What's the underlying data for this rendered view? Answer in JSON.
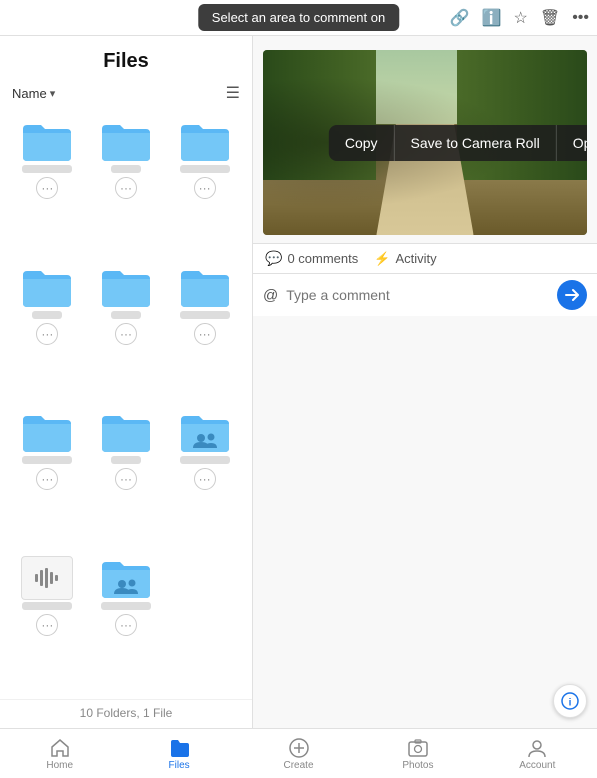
{
  "topbar": {
    "tooltip": "Select an area to comment on",
    "icons": [
      "link",
      "info",
      "star",
      "trash",
      "more"
    ]
  },
  "left": {
    "title": "Files",
    "sort_label": "Name",
    "folders": [
      {
        "id": 1,
        "type": "folder",
        "shared": false
      },
      {
        "id": 2,
        "type": "folder",
        "shared": false
      },
      {
        "id": 3,
        "type": "folder",
        "shared": false
      },
      {
        "id": 4,
        "type": "folder",
        "shared": false
      },
      {
        "id": 5,
        "type": "folder",
        "shared": false
      },
      {
        "id": 6,
        "type": "folder",
        "shared": false
      },
      {
        "id": 7,
        "type": "folder",
        "shared": false
      },
      {
        "id": 8,
        "type": "folder",
        "shared": false
      },
      {
        "id": 9,
        "type": "folder",
        "shared": true
      },
      {
        "id": 10,
        "type": "audio"
      },
      {
        "id": 11,
        "type": "folder",
        "shared": true
      }
    ],
    "summary": "10 Folders, 1 File"
  },
  "context_menu": {
    "copy": "Copy",
    "save_to_camera_roll": "Save to Camera Roll",
    "open_in": "Open in..."
  },
  "right": {
    "info_label": "ⓘ"
  },
  "comments": {
    "count": "0 comments",
    "activity": "Activity",
    "placeholder": "Type a comment"
  },
  "bottom_nav": {
    "items": [
      {
        "id": "home",
        "label": "Home",
        "icon": "⌂",
        "active": false
      },
      {
        "id": "files",
        "label": "Files",
        "icon": "📁",
        "active": true
      },
      {
        "id": "create",
        "label": "Create",
        "icon": "+",
        "active": false
      },
      {
        "id": "photos",
        "label": "Photos",
        "icon": "👤",
        "active": false
      },
      {
        "id": "account",
        "label": "Account",
        "icon": "👤",
        "active": false
      }
    ]
  }
}
